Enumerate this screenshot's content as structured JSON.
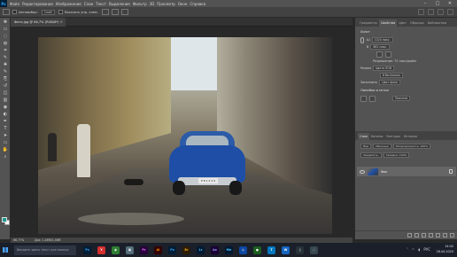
{
  "menubar": {
    "logo": "Ps",
    "items": [
      "Файл",
      "Редактирование",
      "Изображение",
      "Слои",
      "Текст",
      "Выделение",
      "Фильтр",
      "3D",
      "Просмотр",
      "Окно",
      "Справка"
    ],
    "window_controls": [
      "–",
      "□",
      "✕"
    ]
  },
  "options": {
    "auto_select_label": "Автовыбор:",
    "auto_select_value": "Слой",
    "show_controls_label": "Показать упр. элем."
  },
  "document": {
    "tab_title": "Фото.jpg @ 66,7% (RGB/8*)",
    "zoom": "66,77%",
    "doc_info": "Док: 1,46M/1,46M",
    "plate_text": "P 8 1 2 4 9"
  },
  "panels": {
    "top_tabs": [
      "Градиенты",
      "Свойства",
      "Цвет",
      "Образцы",
      "Библиотеки"
    ],
    "active_top_tab": "Свойства",
    "doc_section": "Холст",
    "width_label": "Ш",
    "width_value": "1024 пикс.",
    "height_label": "В",
    "height_value": "661 пикс.",
    "resolution_label": "Разрешение: 72 пикс/дюйм",
    "mode_label": "Режим",
    "mode_value": "Цвета RGB",
    "bits_value": "8 бит/канал",
    "fill_label": "Заполнить",
    "fill_value": "Цвет фона",
    "guides_label": "Линейки и сетки",
    "pixels_value": "Пиксели",
    "layers_tabs": [
      "Слои",
      "Каналы",
      "Контуры",
      "История"
    ],
    "active_layers_tab": "Слои",
    "filter_value": "Вид",
    "blend_value": "Обычные",
    "opacity_label": "Непрозрачность: 100%",
    "lock_label": "Закрепить:",
    "fill_opacity_label": "Заливка: 100%",
    "layer_name": "Фон"
  },
  "toolbar": {
    "tools": [
      "move",
      "marquee",
      "lasso",
      "quick-select",
      "crop",
      "eyedropper",
      "healing",
      "brush",
      "clone",
      "history-brush",
      "eraser",
      "gradient",
      "blur",
      "dodge",
      "pen",
      "type",
      "path-select",
      "shape",
      "hand",
      "zoom"
    ],
    "glyphs": [
      "✥",
      "▭",
      "◌",
      "◍",
      "⌗",
      "✎",
      "✚",
      "✎",
      "⎘",
      "↺",
      "◫",
      "▥",
      "◉",
      "◐",
      "✒",
      "T",
      "➤",
      "▭",
      "✋",
      "⌕"
    ],
    "foreground_color": "#1d9a8e",
    "background_color": "#ffffff"
  },
  "taskbar": {
    "search_placeholder": "Введите здесь текст для поиска",
    "apps": [
      {
        "name": "Ps",
        "color": "#001e36",
        "text_color": "#31a8ff"
      },
      {
        "name": "Y",
        "color": "#d32f2f",
        "text_color": "#ffffff"
      },
      {
        "name": "◉",
        "color": "#2e7d32",
        "text_color": "#ffffff"
      },
      {
        "name": "▣",
        "color": "#546e7a",
        "text_color": "#ffffff"
      },
      {
        "name": "Pr",
        "color": "#2a003e",
        "text_color": "#e77cff"
      },
      {
        "name": "Ai",
        "color": "#330000",
        "text_color": "#ff9a00"
      },
      {
        "name": "Ps",
        "color": "#001e36",
        "text_color": "#31a8ff"
      },
      {
        "name": "Br",
        "color": "#2b1d00",
        "text_color": "#e8a220"
      },
      {
        "name": "Lr",
        "color": "#001a33",
        "text_color": "#4ec9ff"
      },
      {
        "name": "Ae",
        "color": "#1a0033",
        "text_color": "#9999ff"
      },
      {
        "name": "Me",
        "color": "#001a33",
        "text_color": "#4ec9ff"
      },
      {
        "name": "◎",
        "color": "#0d47a1",
        "text_color": "#ffffff"
      },
      {
        "name": "●",
        "color": "#1b5e20",
        "text_color": "#ffffff"
      },
      {
        "name": "T",
        "color": "#0277bd",
        "text_color": "#ffffff"
      },
      {
        "name": "W",
        "color": "#1565c0",
        "text_color": "#ffffff"
      },
      {
        "name": "♫",
        "color": "#263238",
        "text_color": "#ffffff"
      },
      {
        "name": "◌",
        "color": "#37474f",
        "text_color": "#ffffff"
      }
    ],
    "time": "14:02",
    "date": "28.04.2020",
    "lang": "РУС"
  }
}
